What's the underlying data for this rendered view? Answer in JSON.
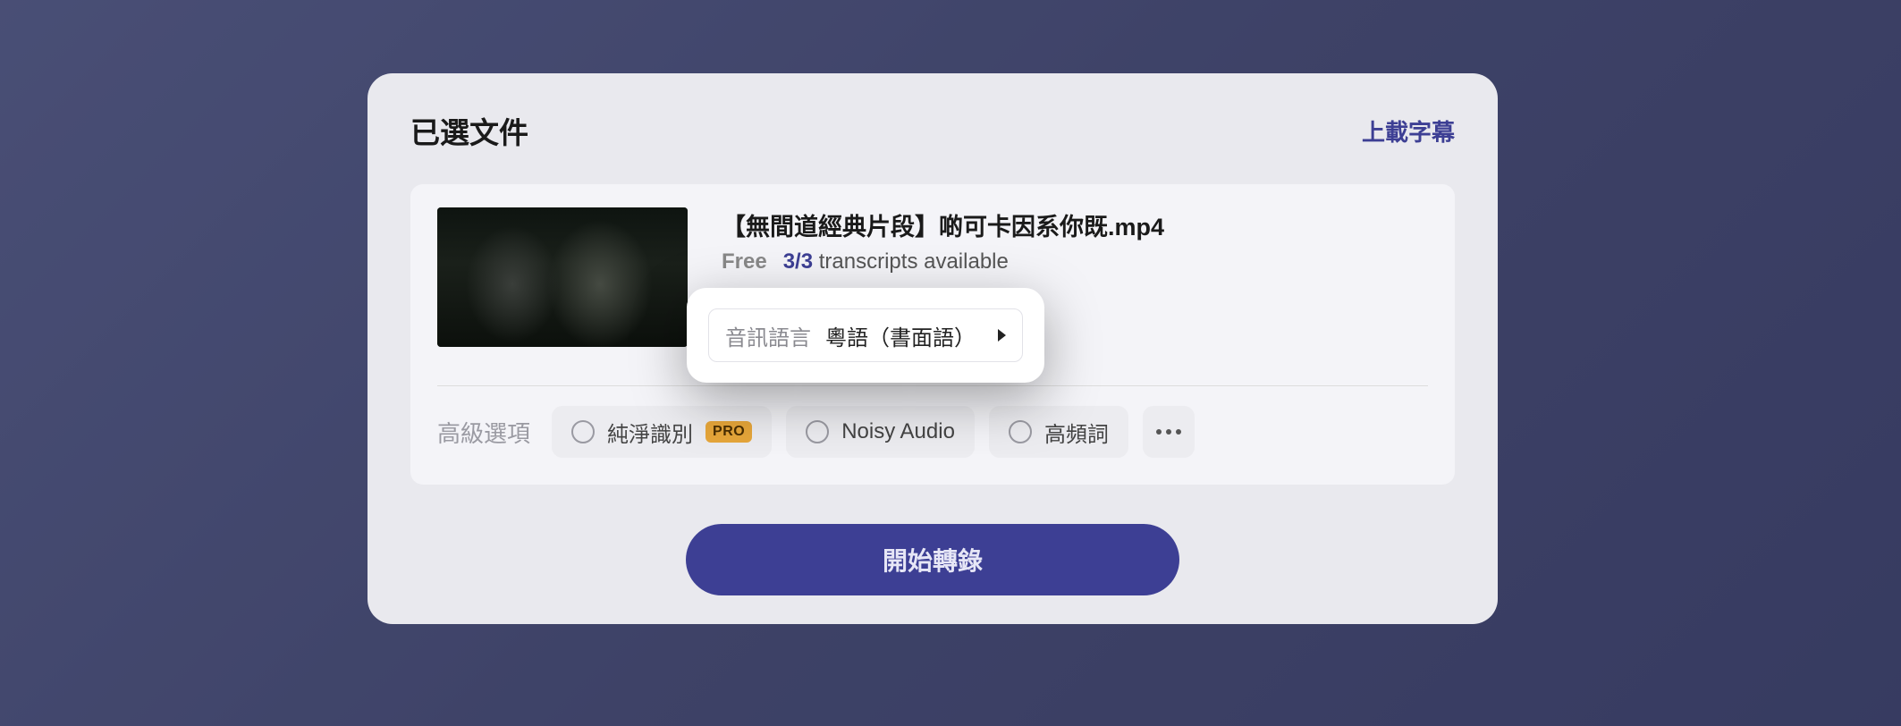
{
  "header": {
    "title": "已選文件",
    "upload_link": "上載字幕"
  },
  "file": {
    "name": "【無間道經典片段】啲可卡因系你既.mp4",
    "plan_label": "Free",
    "count": "3/3",
    "usage_text": "transcripts available"
  },
  "lang": {
    "label": "音訊語言",
    "value": "粵語（書面語）"
  },
  "adv": {
    "label": "高級選項",
    "opt_pure": "純淨識別",
    "pro_badge": "PRO",
    "opt_noisy": "Noisy Audio",
    "opt_hifreq": "高頻詞"
  },
  "cta": "開始轉錄"
}
